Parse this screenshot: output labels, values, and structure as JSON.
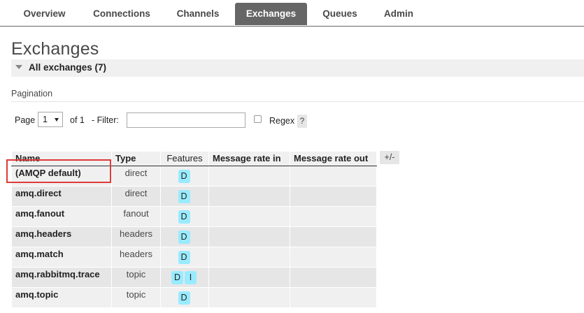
{
  "nav": {
    "tabs": [
      {
        "label": "Overview",
        "active": false
      },
      {
        "label": "Connections",
        "active": false
      },
      {
        "label": "Channels",
        "active": false
      },
      {
        "label": "Exchanges",
        "active": true
      },
      {
        "label": "Queues",
        "active": false
      },
      {
        "label": "Admin",
        "active": false
      }
    ]
  },
  "page": {
    "title": "Exchanges",
    "section_label": "All exchanges (7)",
    "section_toggle_icon": "triangle-down-icon"
  },
  "pagination": {
    "heading": "Pagination",
    "page_label": "Page",
    "page_value": "1",
    "of_label": "of 1",
    "filter_label": "- Filter:",
    "filter_value": "",
    "regex_label": "Regex",
    "regex_checked": false,
    "help_label": "?"
  },
  "table": {
    "headers": {
      "name": "Name",
      "type": "Type",
      "features": "Features",
      "rate_in": "Message rate in",
      "rate_out": "Message rate out"
    },
    "columns_toggle": "+/-",
    "badge_color": "#99ebff",
    "highlight_color": "#e03a3a",
    "rows": [
      {
        "name": "(AMQP default)",
        "type": "direct",
        "features": [
          "D"
        ],
        "rate_in": "",
        "rate_out": ""
      },
      {
        "name": "amq.direct",
        "type": "direct",
        "features": [
          "D"
        ],
        "rate_in": "",
        "rate_out": ""
      },
      {
        "name": "amq.fanout",
        "type": "fanout",
        "features": [
          "D"
        ],
        "rate_in": "",
        "rate_out": ""
      },
      {
        "name": "amq.headers",
        "type": "headers",
        "features": [
          "D"
        ],
        "rate_in": "",
        "rate_out": ""
      },
      {
        "name": "amq.match",
        "type": "headers",
        "features": [
          "D"
        ],
        "rate_in": "",
        "rate_out": ""
      },
      {
        "name": "amq.rabbitmq.trace",
        "type": "topic",
        "features": [
          "D",
          "I"
        ],
        "rate_in": "",
        "rate_out": ""
      },
      {
        "name": "amq.topic",
        "type": "topic",
        "features": [
          "D"
        ],
        "rate_in": "",
        "rate_out": ""
      }
    ]
  }
}
